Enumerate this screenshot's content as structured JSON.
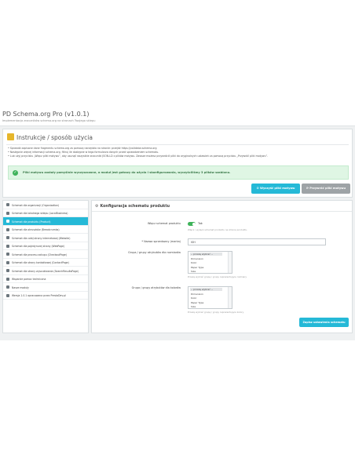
{
  "header": {
    "title": "PD Schema.org Pro (v1.0.1)",
    "subtitle": "Implementacja znaczników schema.org na stronach Twojego sklepu"
  },
  "instructions": {
    "title": "Instrukcje / sposób użycia",
    "items": [
      "Sprawdź zapisane dane fragmentu schema.org za pomocą narzędzia na stronie: przejdź https://validator.schema.org",
      "Następnie więcej informacji schema.org, filtruj ile dostępne w tego formularza danych przed sprawdzeniem schematu.",
      "Lub użyj przycisku „Włącz pliki motywu”, aby usunąć wszystkie znaczniki JSON-LD z plików motywu. Zawsze możesz przywrócić pliki do oryginalnych ustawień za pomocą przycisku „Przywróć pliki motywu”."
    ],
    "alert": "Pliki motywu zostały pomyślnie wyczyszczone, a moduł jest gotowy do użycia i skonfigurowania, wyczyściliśmy 3 plików szablonu."
  },
  "buttons": {
    "enable_theme": "Wyczyść pliki motywu",
    "restore_theme": "Przywróć pliki motywu"
  },
  "sidebar": {
    "items": [
      {
        "label": "Schemat dla organizacji (Organization)",
        "active": false
      },
      {
        "label": "Schemat dla lokalnego sklepu (LocalBusiness)",
        "active": false
      },
      {
        "label": "Schemat dla produktu (Product)",
        "active": true
      },
      {
        "label": "Schemat dla okruszków (Breadcrumbs)",
        "active": false
      },
      {
        "label": "Schemat dla całej strony internetowej (Website)",
        "active": false
      },
      {
        "label": "Schemat dla pojedynczej strony (WebPage)",
        "active": false
      },
      {
        "label": "Schemat dla procesu zakupu (CheckoutPage)",
        "active": false
      },
      {
        "label": "Schemat dla strony kontaktowej (ContactPage)",
        "active": false
      },
      {
        "label": "Schemat dla strony wyszukiwania (SearchResultsPage)",
        "active": false
      },
      {
        "label": "Wsparcie pomoc techniczna",
        "active": false
      },
      {
        "label": "Nasze moduły",
        "active": false
      },
      {
        "label": "Wersja 1.0.1 opracowana przez PrestaDev.pl",
        "active": false
      }
    ]
  },
  "config": {
    "title": "Konfiguracja schematu produktu",
    "enable_label": "Włącz schemat produktu",
    "enable_value": "Tak",
    "enable_help": "Włącz / wyłącz schemat produktu na stronie produktu.",
    "brand_label": "* Nazwa sprzedawcy (marka)",
    "brand_value": "ISH",
    "color_label": "Grupa / grupy atrybutów dla rozmiarów",
    "color_options": [
      "-- proszę wybrać --",
      "Dimension",
      "Kolor",
      "Paper Type",
      "Size"
    ],
    "color_help": "Proszę wybrać grupę / grupy reprezentujące rozmiary",
    "size_label": "Grupa / grupy atrybutów dla kolorów",
    "size_options": [
      "-- proszę wybrać --",
      "Dimension",
      "Kolor",
      "Paper Type",
      "Size"
    ],
    "size_help": "Proszę wybrać grupę / grupy reprezentujące kolory",
    "save": "Zapisz ustawienia schematu"
  },
  "colors": {
    "accent": "#25b9d7",
    "success": "#3fb35b",
    "warning": "#e6b62b",
    "grey_button": "#9ea3a6"
  }
}
